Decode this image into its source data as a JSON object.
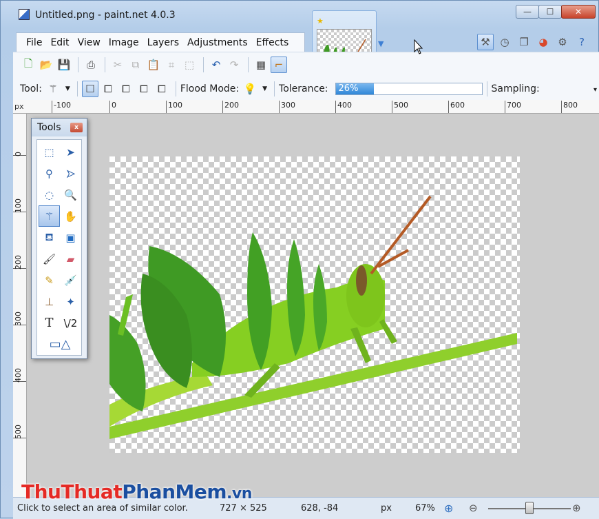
{
  "window": {
    "title": "Untitled.png - paint.net 4.0.3",
    "minimize_glyph": "—",
    "maximize_glyph": "☐",
    "close_glyph": "✕"
  },
  "menu": {
    "items": [
      "File",
      "Edit",
      "View",
      "Image",
      "Layers",
      "Adjustments",
      "Effects"
    ]
  },
  "toolbar2": {
    "tool_label": "Tool:",
    "flood_mode_label": "Flood Mode:",
    "tolerance_label": "Tolerance:",
    "tolerance_value": "26%",
    "tolerance_fraction": 0.26,
    "sampling_label": "Sampling:"
  },
  "ruler": {
    "unit": "px",
    "h_labels": [
      "-100",
      "0",
      "100",
      "200",
      "300",
      "400",
      "500",
      "600",
      "700",
      "800"
    ],
    "v_labels": [
      "0",
      "100",
      "200",
      "300",
      "400",
      "500"
    ]
  },
  "tools_window": {
    "title": "Tools",
    "close_glyph": "x"
  },
  "status": {
    "hint": "Click to select an area of similar color.",
    "image_size": "727 × 525",
    "cursor_pos": "628, -84",
    "unit": "px",
    "zoom": "67%",
    "zoom_slider_fraction": 0.5
  },
  "watermark": {
    "part1": "Thu",
    "part2": "Thuat",
    "part3": "PhanMem",
    "part4": ".vn"
  },
  "colors": {
    "accent": "#3b80d8",
    "grasshopper": "#7cc81e",
    "leaf": "#3f9a24"
  }
}
